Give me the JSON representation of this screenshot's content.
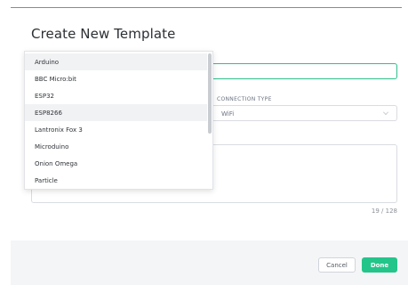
{
  "modal": {
    "title": "Create New Template"
  },
  "hardware_dropdown": {
    "options": [
      {
        "label": "Arduino",
        "highlighted": true
      },
      {
        "label": "BBC Micro:bit",
        "highlighted": false
      },
      {
        "label": "ESP32",
        "highlighted": false
      },
      {
        "label": "ESP8266",
        "highlighted": true
      },
      {
        "label": "Lantronix Fox 3",
        "highlighted": false
      },
      {
        "label": "Microduino",
        "highlighted": false
      },
      {
        "label": "Onion Omega",
        "highlighted": false
      },
      {
        "label": "Particle",
        "highlighted": false
      }
    ]
  },
  "connection": {
    "label": "CONNECTION TYPE",
    "value": "WiFi"
  },
  "description": {
    "char_count": "19 / 128"
  },
  "footer": {
    "cancel_label": "Cancel",
    "done_label": "Done"
  },
  "colors": {
    "accent": "#23c58a",
    "focus_border": "#2dbf8a",
    "footer_bg": "#f4f5f7"
  }
}
